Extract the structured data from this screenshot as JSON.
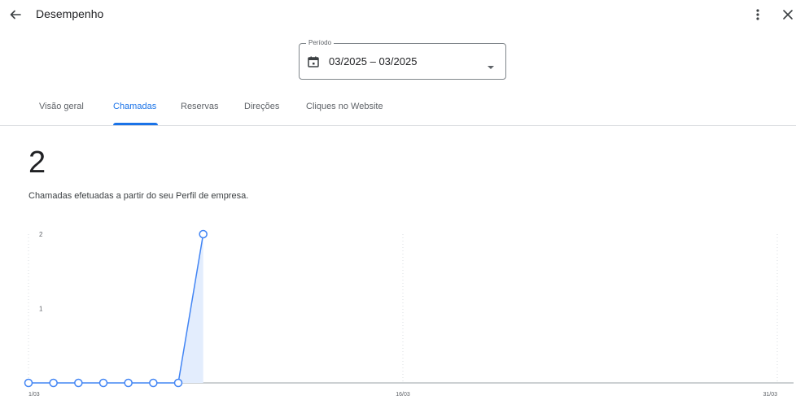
{
  "header": {
    "title": "Desempenho",
    "back_icon": "arrow-back-icon",
    "more_icon": "more-vert-icon",
    "close_icon": "close-icon"
  },
  "period": {
    "label": "Período",
    "value": "03/2025 – 03/2025",
    "icon": "calendar-icon"
  },
  "tabs": [
    {
      "label": "Visão geral",
      "active": false
    },
    {
      "label": "Chamadas",
      "active": true
    },
    {
      "label": "Reservas",
      "active": false
    },
    {
      "label": "Direções",
      "active": false
    },
    {
      "label": "Cliques no Website",
      "active": false
    }
  ],
  "metric": {
    "value": "2",
    "description": "Chamadas efetuadas a partir do seu Perfil de empresa."
  },
  "colors": {
    "accent": "#1a73e8",
    "line": "#4285f4",
    "area": "#e3edfd"
  },
  "chart_data": {
    "type": "line",
    "x": [
      1,
      2,
      3,
      4,
      5,
      6,
      7,
      8
    ],
    "values": [
      0,
      0,
      0,
      0,
      0,
      0,
      0,
      2
    ],
    "xlim": [
      1,
      31
    ],
    "ylim": [
      0,
      2
    ],
    "y_ticks": [
      "1",
      "2"
    ],
    "x_ticks": [
      {
        "label": "1/03",
        "day": 1
      },
      {
        "label": "16/03",
        "day": 16
      },
      {
        "label": "31/03",
        "day": 31
      }
    ],
    "highlight_point": 8,
    "grid": "vertical-dotted"
  }
}
